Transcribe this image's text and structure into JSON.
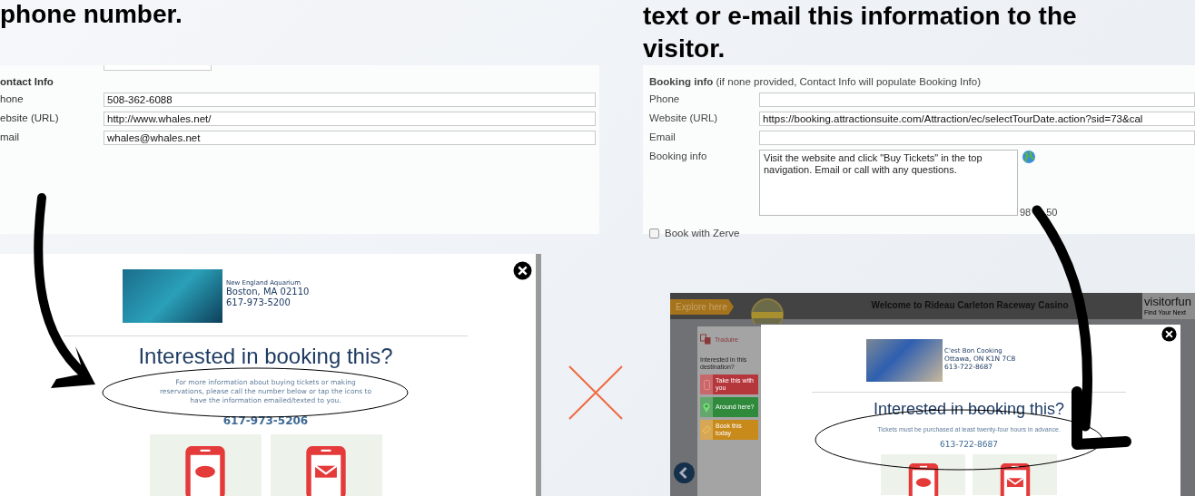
{
  "headings": [
    {
      "text": "phone number."
    },
    {
      "text": "text or e-mail this information to the visitor."
    }
  ],
  "contact_form": {
    "section": "ontact Info",
    "fields": [
      {
        "label": "hone",
        "value": "508-362-6088"
      },
      {
        "label": "ebsite (URL)",
        "value": "http://www.whales.net/"
      },
      {
        "label": "mail",
        "value": "whales@whales.net"
      }
    ]
  },
  "booking_form": {
    "section_title": "Booking info",
    "section_note": "(if none provided, Contact Info will populate Booking Info)",
    "fields": [
      {
        "label": "Phone"
      },
      {
        "label": "Website (URL)",
        "value": "https://booking.attractionsuite.com/Attraction/ec/selectTourDate.action?sid=73&cal"
      },
      {
        "label": "Email"
      }
    ],
    "textarea": {
      "label": "Booking info",
      "value": "Visit the website and click \"Buy Tickets\" in the top navigation. Email or call with any questions."
    },
    "counter_parts": [
      "98",
      "50"
    ],
    "checkbox": {
      "label": "Book with Zerve",
      "checked": false
    }
  },
  "aquarium_popup": {
    "venue": "New England Aquarium",
    "address": "Boston, MA 02110",
    "phone": "617-973-5200",
    "title": "Interested in booking this?",
    "message": "For more information about buying tickets or making reservations, please call the number below or tap the icons to have the information emailed/texted to you.",
    "booking_phone": "617-973-5206",
    "tiles": [
      {
        "kind": "message"
      },
      {
        "kind": "mail"
      }
    ]
  },
  "casino_page": {
    "explore_tag": "Explore here",
    "page_title": "Welcome to Rideau Carleton Raceway Casino",
    "brand": "visitorfun",
    "brand_tagline": "Find Your Next",
    "sidebar": {
      "translate": "Traduire",
      "prompt": "Interested in this destination?",
      "actions": [
        {
          "kind": "phone",
          "label": "Take this with you",
          "color": "#b5363b"
        },
        {
          "kind": "pin",
          "label": "Around here?",
          "color": "#2f8a3c"
        },
        {
          "kind": "ticket",
          "label": "Book this today",
          "color": "#c98a1c"
        }
      ]
    },
    "popup": {
      "venue": "C'est Bon Cooking",
      "address": "Ottawa, ON K1N 7C8",
      "phone": "613-722-8687",
      "title": "Interested in booking this?",
      "message": "Tickets must be purchased at least twenty-four hours in advance.",
      "booking_phone": "613-722-8687",
      "tiles": [
        {
          "kind": "message"
        },
        {
          "kind": "mail"
        }
      ]
    }
  }
}
